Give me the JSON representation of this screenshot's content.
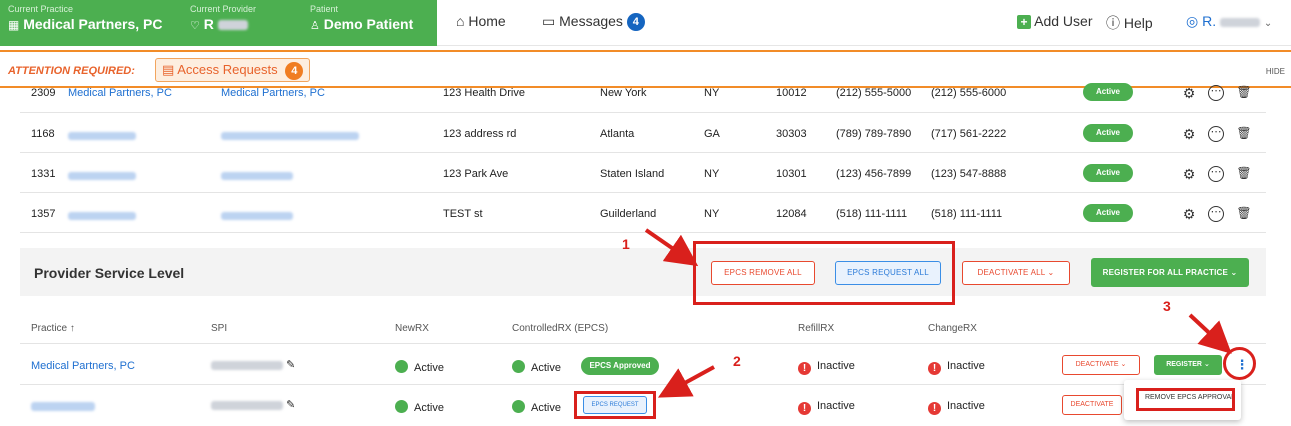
{
  "header": {
    "practice_label": "Current Practice",
    "practice_name": "Medical Partners, PC",
    "provider_label": "Current Provider",
    "provider_name": "R",
    "patient_label": "Patient",
    "patient_name": "Demo Patient",
    "home": "Home",
    "messages": "Messages",
    "messages_count": "4",
    "add_user": "Add User",
    "help": "Help",
    "user_initial": "R."
  },
  "attention": {
    "label": "ATTENTION REQUIRED:",
    "access_requests": "Access Requests",
    "access_count": "4",
    "hide": "HIDE"
  },
  "table_rows": [
    {
      "id": "2309",
      "practice": "Medical Partners, PC",
      "provider": "Medical Partners, PC",
      "address": "123 Health Drive",
      "city": "New York",
      "state": "NY",
      "zip": "10012",
      "phone": "(212) 555-5000",
      "fax": "(212) 555-6000",
      "status": "Active"
    },
    {
      "id": "1168",
      "practice": "",
      "provider": "",
      "address": "123 address rd",
      "city": "Atlanta",
      "state": "GA",
      "zip": "30303",
      "phone": "(789) 789-7890",
      "fax": "(717) 561-2222",
      "status": "Active"
    },
    {
      "id": "1331",
      "practice": "",
      "provider": "",
      "address": "123 Park Ave",
      "city": "Staten Island",
      "state": "NY",
      "zip": "10301",
      "phone": "(123) 456-7899",
      "fax": "(123) 547-8888",
      "status": "Active"
    },
    {
      "id": "1357",
      "practice": "",
      "provider": "",
      "address": "TEST st",
      "city": "Guilderland",
      "state": "NY",
      "zip": "12084",
      "phone": "(518) 111-1111",
      "fax": "(518) 111-1111",
      "status": "Active"
    }
  ],
  "service_level": {
    "title": "Provider Service Level",
    "epcs_remove_all": "EPCS REMOVE ALL",
    "epcs_request_all": "EPCS REQUEST ALL",
    "deactivate_all": "DEACTIVATE ALL",
    "register_all": "REGISTER FOR ALL PRACTICE"
  },
  "columns": {
    "practice": "Practice",
    "spi": "SPI",
    "newrx": "NewRX",
    "controlled": "ControlledRX (EPCS)",
    "refill": "RefillRX",
    "change": "ChangeRX"
  },
  "sl_rows": [
    {
      "practice": "Medical Partners, PC",
      "newrx": "Active",
      "controlled": "Active",
      "epcs": "EPCS Approved",
      "refill": "Inactive",
      "change": "Inactive",
      "deactivate": "DEACTIVATE",
      "register": "REGISTER"
    },
    {
      "practice": "",
      "newrx": "Active",
      "controlled": "Active",
      "epcs": "EPCS REQUEST",
      "refill": "Inactive",
      "change": "Inactive",
      "deactivate": "DEACTIVATE"
    }
  ],
  "menu": {
    "remove_epcs": "REMOVE EPCS APPROVAL"
  },
  "annotations": [
    "1",
    "2",
    "3"
  ],
  "colors": {
    "accent_green": "#4caf50",
    "attention_orange": "#f28c28",
    "annotation_red": "#d9201c",
    "link_blue": "#1e6fd0"
  }
}
